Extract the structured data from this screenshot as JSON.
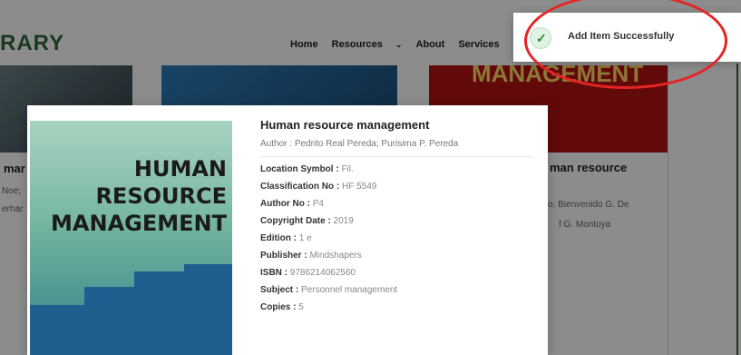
{
  "brand": {
    "text": "RARY"
  },
  "nav": {
    "home": "Home",
    "resources": "Resources",
    "resources_chevron": "⌄",
    "about": "About",
    "services": "Services"
  },
  "background": {
    "left_title": "mar",
    "left_author1": "Noe;",
    "left_author2": "erhar",
    "right_heading": "MANAGEMENT",
    "right_title": "man resource",
    "right_author1": "o; Bienvenido G. De",
    "right_author2": "f G. Montoya"
  },
  "modal": {
    "title": "Human resource management",
    "author_label": "Author : ",
    "author_value": "Pedrito Real Pereda; Purisima P. Pereda",
    "fields": [
      {
        "key": "Location Symbol : ",
        "value": "Fil."
      },
      {
        "key": "Classification No : ",
        "value": "HF 5549"
      },
      {
        "key": "Author No : ",
        "value": "P4"
      },
      {
        "key": "Copyright Date : ",
        "value": "2019"
      },
      {
        "key": "Edition : ",
        "value": "1 e"
      },
      {
        "key": "Publisher : ",
        "value": "Mindshapers"
      },
      {
        "key": "ISBN : ",
        "value": "9786214062560"
      },
      {
        "key": "Subject : ",
        "value": "Personnel management"
      },
      {
        "key": "Copies : ",
        "value": "5"
      }
    ],
    "cover_lines": [
      "HUMAN",
      "RESOURCE",
      "MANAGEMENT"
    ]
  },
  "toast": {
    "message": "Add Item Successfully",
    "icon": "check-icon"
  }
}
